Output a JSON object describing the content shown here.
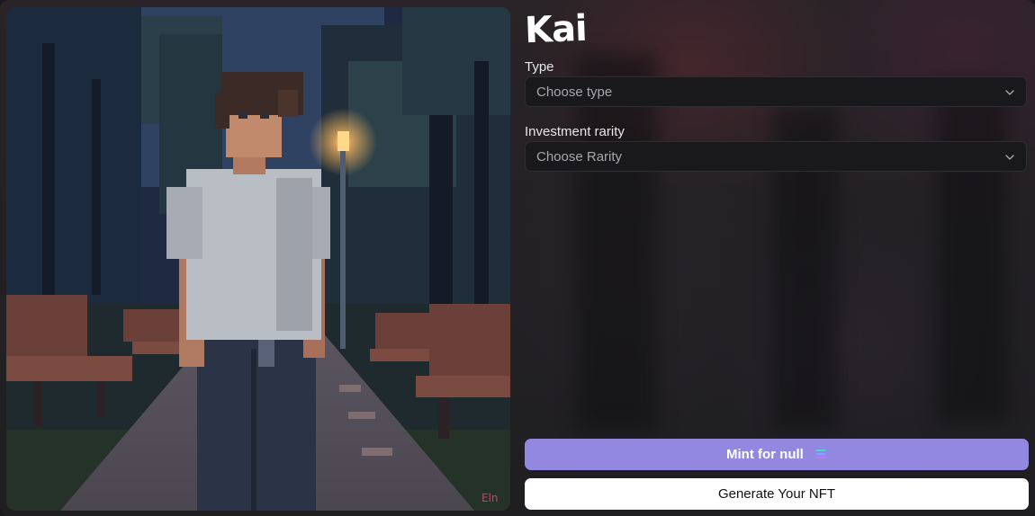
{
  "nft": {
    "name": "Kai"
  },
  "form": {
    "type_label": "Type",
    "type_placeholder": "Choose type",
    "rarity_label": "Investment rarity",
    "rarity_placeholder": "Choose Rarity"
  },
  "actions": {
    "mint_label": "Mint for null",
    "mint_icon": "solana-icon",
    "generate_label": "Generate Your NFT"
  },
  "artwork": {
    "signature": "Eln"
  },
  "colors": {
    "mint_button": "#9288e0",
    "generate_button": "#ffffff",
    "background": "#1d1c1f"
  }
}
